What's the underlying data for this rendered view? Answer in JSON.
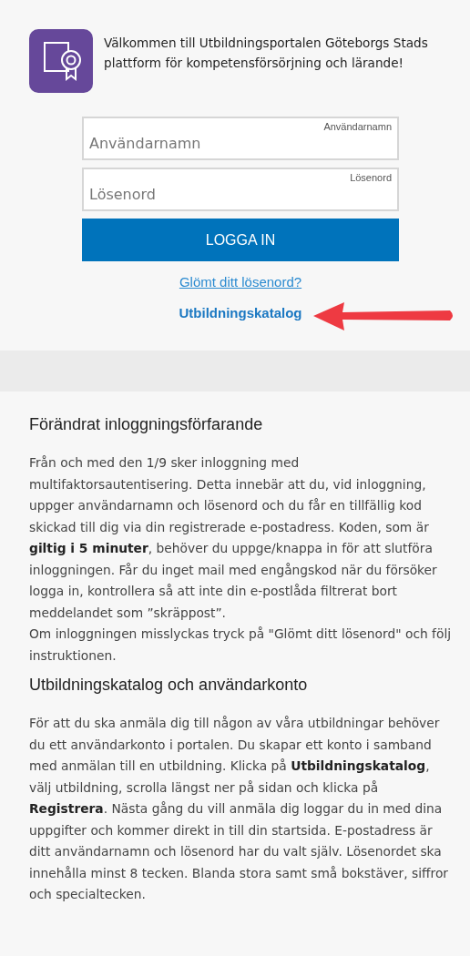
{
  "welcome": {
    "text": "Välkommen till Utbildningsportalen Göteborgs Stads plattform för kompetensförsörjning och lärande!"
  },
  "login_form": {
    "fields": [
      {
        "placeholder": "Användarnamn",
        "label": "Användarnamn"
      },
      {
        "placeholder": "Lösenord",
        "label": "Lösenord"
      }
    ],
    "submit": "LOGGA IN",
    "forgot_link": "Glömt ditt lösenord?",
    "catalog_link": "Utbildningskatalog"
  },
  "sections": [
    {
      "title": "Förändrat inloggningsförfarande",
      "paragraphs": [
        "Från och med den 1/9 sker inloggning med multifaktorsautentisering. Detta innebär att du, vid inloggning, uppger användarnamn och lösenord och du får en tillfällig kod skickad till dig via din registrerade e-postadress. Koden, som är **giltig i 5 minuter**, behöver du uppge/knappa in för att slutföra inloggningen. Får du inget mail med engångskod när du försöker logga in, kontrollera så att inte din e-postlåda filtrerat bort meddelandet som ”skräppost”.",
        "Om inloggningen misslyckas tryck på \"Glömt ditt lösenord\" och följ instruktionen."
      ]
    },
    {
      "title": "Utbildningskatalog och användarkonto",
      "paragraphs": [
        "För att du ska anmäla dig till någon av våra utbildningar behöver du ett användarkonto i portalen. Du skapar ett konto i samband med anmälan till en utbildning. Klicka på **Utbildningskatalog**, välj utbildning, scrolla längst ner på sidan och klicka på **Registrera**. Nästa gång du vill anmäla dig loggar du in med dina uppgifter och kommer direkt in till din startsida. E-postadress är ditt användarnamn och lösenord har du valt själv. Lösenordet ska innehålla minst 8 tecken. Blanda stora samt små bokstäver, siffror och specialtecken."
      ]
    }
  ]
}
